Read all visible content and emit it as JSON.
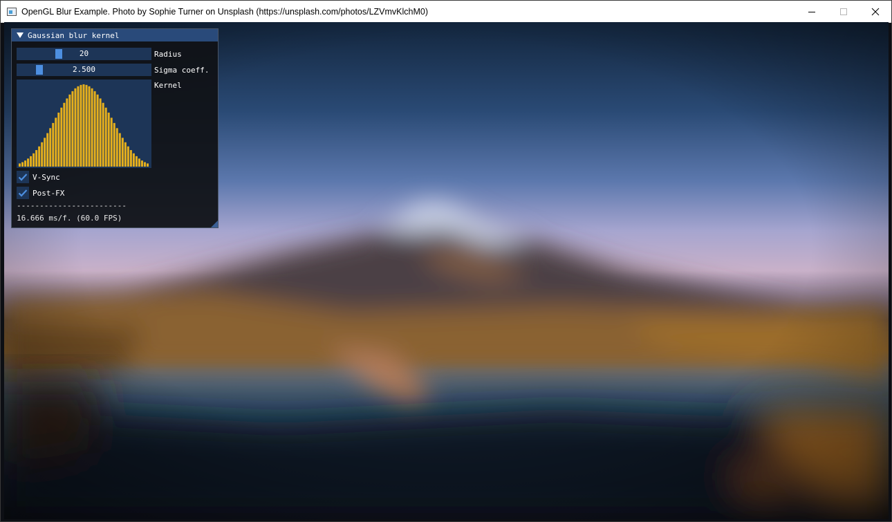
{
  "window": {
    "title": "OpenGL Blur Example. Photo by Sophie Turner on Unsplash (https://unsplash.com/photos/LZVmvKlchM0)",
    "controls": [
      "minimize-icon",
      "maximize-icon",
      "close-icon"
    ]
  },
  "panel": {
    "header": "Gaussian blur kernel",
    "radius": {
      "value": "20",
      "label": "Radius",
      "fraction": 0.3
    },
    "sigma": {
      "value": "2.500",
      "label": "Sigma coeff.",
      "fraction": 0.15
    },
    "kernel": {
      "label": "Kernel",
      "bar_color": "#e6b01d",
      "values": [
        0.037,
        0.052,
        0.071,
        0.094,
        0.122,
        0.155,
        0.193,
        0.236,
        0.284,
        0.336,
        0.391,
        0.449,
        0.509,
        0.57,
        0.63,
        0.688,
        0.744,
        0.795,
        0.841,
        0.88,
        0.913,
        0.937,
        0.953,
        0.96,
        0.953,
        0.937,
        0.913,
        0.88,
        0.841,
        0.795,
        0.744,
        0.688,
        0.63,
        0.57,
        0.509,
        0.449,
        0.391,
        0.336,
        0.284,
        0.236,
        0.193,
        0.155,
        0.122,
        0.094,
        0.071,
        0.052,
        0.037
      ]
    },
    "vsync": {
      "label": "V-Sync",
      "checked": true
    },
    "postfx": {
      "label": "Post-FX",
      "checked": true
    },
    "separator": "------------------------",
    "fps_text": "16.666 ms/f. (60.0 FPS)"
  },
  "colors": {
    "accent": "#4d8fe0",
    "header": "#294a7a",
    "frame": "#1d3557"
  }
}
